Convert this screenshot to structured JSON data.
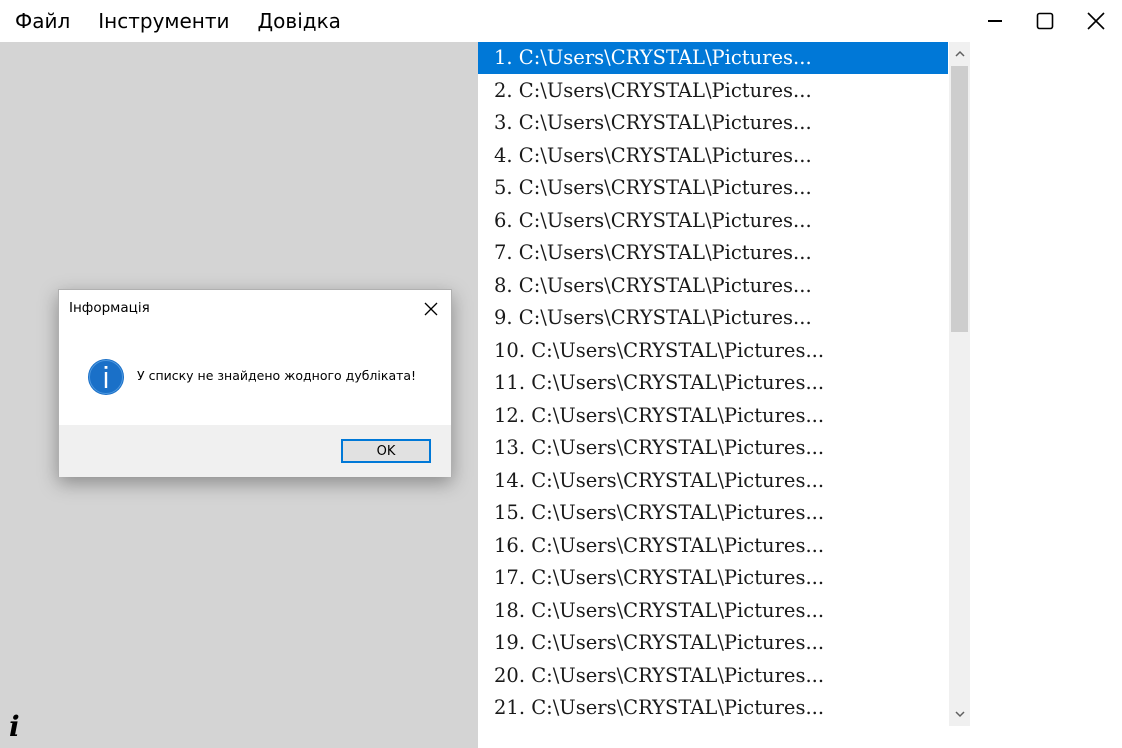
{
  "menu": {
    "items": [
      {
        "label": "Файл"
      },
      {
        "label": "Інструменти"
      },
      {
        "label": "Довідка"
      }
    ]
  },
  "window_controls": {
    "minimize": "minimize-icon",
    "maximize": "maximize-icon",
    "close": "close-icon"
  },
  "list": {
    "selected_index": 0,
    "items": [
      "1. C:\\Users\\CRYSTAL\\Pictures...",
      "2. C:\\Users\\CRYSTAL\\Pictures...",
      "3. C:\\Users\\CRYSTAL\\Pictures...",
      "4. C:\\Users\\CRYSTAL\\Pictures...",
      "5. C:\\Users\\CRYSTAL\\Pictures...",
      "6. C:\\Users\\CRYSTAL\\Pictures...",
      "7. C:\\Users\\CRYSTAL\\Pictures...",
      "8. C:\\Users\\CRYSTAL\\Pictures...",
      "9. C:\\Users\\CRYSTAL\\Pictures...",
      "10. C:\\Users\\CRYSTAL\\Pictures...",
      "11. C:\\Users\\CRYSTAL\\Pictures...",
      "12. C:\\Users\\CRYSTAL\\Pictures...",
      "13. C:\\Users\\CRYSTAL\\Pictures...",
      "14. C:\\Users\\CRYSTAL\\Pictures...",
      "15. C:\\Users\\CRYSTAL\\Pictures...",
      "16. C:\\Users\\CRYSTAL\\Pictures...",
      "17. C:\\Users\\CRYSTAL\\Pictures...",
      "18. C:\\Users\\CRYSTAL\\Pictures...",
      "19. C:\\Users\\CRYSTAL\\Pictures...",
      "20. C:\\Users\\CRYSTAL\\Pictures...",
      "21. C:\\Users\\CRYSTAL\\Pictures..."
    ]
  },
  "dialog": {
    "title": "Інформація",
    "message": "У списку не знайдено жодного дубліката!",
    "ok_label": "OK",
    "icon": "info-icon"
  },
  "status": {
    "info_glyph": "i"
  },
  "colors": {
    "accent": "#0078d7",
    "panel_bg": "#d4d4d4",
    "dialog_footer": "#f0f0f0"
  }
}
